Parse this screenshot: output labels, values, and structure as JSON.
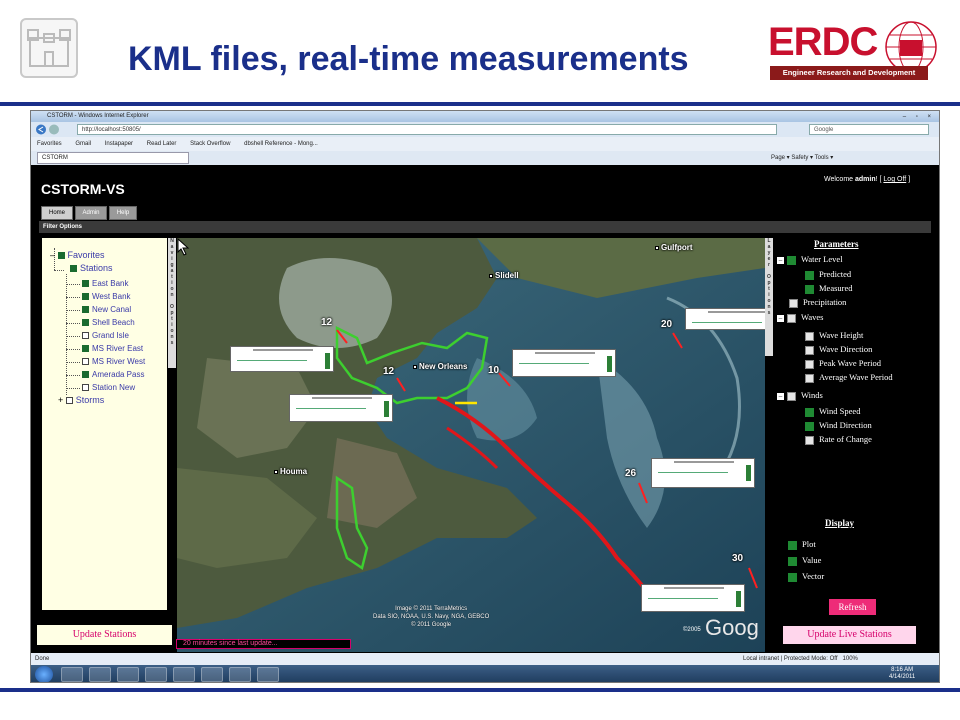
{
  "slide": {
    "title": "KML files, real-time measurements",
    "logo_text": "ERDC",
    "logo_subtitle": "Engineer Research and Development Center"
  },
  "browser": {
    "window_title": "CSTORM - Windows Internet Explorer",
    "window_buttons": "– ▫ ×",
    "url": "http://localhost:50805/",
    "search_placeholder": "Google",
    "favorites": [
      "Favorites",
      "Gmail",
      "Instapaper",
      "Read Later",
      "Stack Overflow",
      "dbshell Reference - Mong..."
    ],
    "tab_label": "CSTORM",
    "tools": "Page ▾  Safety ▾  Tools ▾",
    "status_left": "Done",
    "status_zone": "Local intranet | Protected Mode: Off",
    "zoom": "100%",
    "clock_time": "8:16 AM",
    "clock_date": "4/14/2011"
  },
  "app": {
    "title": "CSTORM-VS",
    "welcome_prefix": "Welcome ",
    "welcome_user": "admin",
    "welcome_sep": "! [ ",
    "logoff": "Log Off",
    "welcome_suffix": " ]",
    "nav_tabs": [
      "Home",
      "Admin",
      "Help"
    ],
    "filter_label": "Filter Options",
    "nav_options_label": "Navigation Options",
    "layer_options_label": "Layer Options",
    "tree": {
      "favorites": "Favorites",
      "stations": "Stations",
      "station_items": [
        {
          "label": "East Bank",
          "checked": true
        },
        {
          "label": "West Bank",
          "checked": true
        },
        {
          "label": "New Canal",
          "checked": true
        },
        {
          "label": "Shell Beach",
          "checked": true
        },
        {
          "label": "Grand  Isle",
          "checked": false
        },
        {
          "label": "MS River East",
          "checked": true
        },
        {
          "label": "MS River West",
          "checked": false
        },
        {
          "label": "Amerada Pass",
          "checked": true
        },
        {
          "label": "Station New",
          "checked": false
        }
      ],
      "storms": "Storms",
      "minus": "–",
      "plus": "+"
    },
    "map": {
      "cities": [
        "Gulfport",
        "Slidell",
        "New Orleans",
        "Houma"
      ],
      "station_values": [
        "12",
        "12",
        "10",
        "20",
        "26",
        "30"
      ],
      "attribution_line1": "Image © 2011 TerraMetrics",
      "attribution_line2": "Data SIO, NOAA, U.S. Navy, NGA, GEBCO",
      "attribution_line3": "© 2011 Google",
      "copyright": "©2005",
      "google": "Goog"
    },
    "parameters": {
      "heading": "Parameters",
      "water_level": "Water Level",
      "predicted": "Predicted",
      "measured": "Measured",
      "precipitation": "Precipitation",
      "waves": "Waves",
      "wave_height": "Wave Height",
      "wave_direction": "Wave Direction",
      "peak_wave_period": "Peak Wave Period",
      "average_wave_period": "Average Wave Period",
      "winds": "Winds",
      "wind_speed": "Wind Speed",
      "wind_direction": "Wind Direction",
      "rate_of_change": "Rate of Change",
      "toggle": "–"
    },
    "display": {
      "heading": "Display",
      "plot": "Plot",
      "value": "Value",
      "vector": "Vector"
    },
    "refresh": "Refresh",
    "update_live": "Update Live Stations",
    "update_stations": "Update Stations",
    "minutes_since": "20 minutes since last update..."
  },
  "colors": {
    "title_blue": "#1a2f8a",
    "erdc_red": "#c8102e",
    "check_green": "#1f8a33",
    "pink": "#d6006b",
    "levee_green": "#3dcf2f",
    "track_red": "#e0161a"
  }
}
